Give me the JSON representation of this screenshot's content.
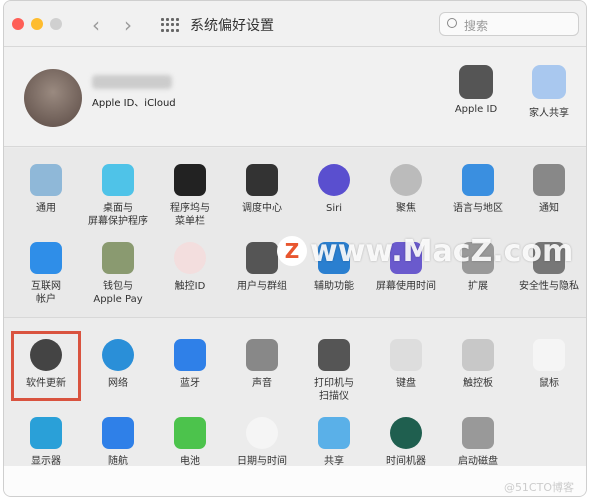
{
  "window": {
    "title": "系统偏好设置",
    "search_placeholder": "搜索"
  },
  "profile": {
    "subtitle": "Apple ID、iCloud",
    "items": [
      {
        "label": "Apple ID",
        "icon": "apple-icon"
      },
      {
        "label": "家人共享",
        "icon": "family-icon"
      }
    ]
  },
  "rows": [
    [
      {
        "label": "通用",
        "icon": "general-icon",
        "color": "#8fb8d8"
      },
      {
        "label": "桌面与\n屏幕保护程序",
        "icon": "desktop-icon",
        "color": "#4fc3e8"
      },
      {
        "label": "程序坞与\n菜单栏",
        "icon": "dock-icon",
        "color": "#222222"
      },
      {
        "label": "调度中心",
        "icon": "mission-control-icon",
        "color": "#333333"
      },
      {
        "label": "Siri",
        "icon": "siri-icon",
        "color": "#5a4fcf"
      },
      {
        "label": "聚焦",
        "icon": "spotlight-icon",
        "color": "#bbbbbb"
      },
      {
        "label": "语言与地区",
        "icon": "language-icon",
        "color": "#3a8fe0"
      },
      {
        "label": "通知",
        "icon": "notification-icon",
        "color": "#888888"
      }
    ],
    [
      {
        "label": "互联网\n帐户",
        "icon": "internet-accounts-icon",
        "color": "#2f8ee8"
      },
      {
        "label": "钱包与\nApple Pay",
        "icon": "wallet-icon",
        "color": "#8a9a70"
      },
      {
        "label": "触控ID",
        "icon": "touch-id-icon",
        "color": "#f3dede"
      },
      {
        "label": "用户与群组",
        "icon": "users-icon",
        "color": "#555555"
      },
      {
        "label": "辅助功能",
        "icon": "accessibility-icon",
        "color": "#2a7fd0"
      },
      {
        "label": "屏幕使用时间",
        "icon": "screen-time-icon",
        "color": "#6a5acd"
      },
      {
        "label": "扩展",
        "icon": "extensions-icon",
        "color": "#999999"
      },
      {
        "label": "安全性与隐私",
        "icon": "security-icon",
        "color": "#777777"
      }
    ],
    [
      {
        "label": "软件更新",
        "icon": "software-update-icon",
        "color": "#444444"
      },
      {
        "label": "网络",
        "icon": "network-icon",
        "color": "#2a8fd8"
      },
      {
        "label": "蓝牙",
        "icon": "bluetooth-icon",
        "color": "#2f80e8"
      },
      {
        "label": "声音",
        "icon": "sound-icon",
        "color": "#888888"
      },
      {
        "label": "打印机与\n扫描仪",
        "icon": "printer-icon",
        "color": "#555555"
      },
      {
        "label": "键盘",
        "icon": "keyboard-icon",
        "color": "#dddddd"
      },
      {
        "label": "触控板",
        "icon": "trackpad-icon",
        "color": "#c8c8c8"
      },
      {
        "label": "鼠标",
        "icon": "mouse-icon",
        "color": "#f5f5f5"
      }
    ],
    [
      {
        "label": "显示器",
        "icon": "display-icon",
        "color": "#2aa0d8"
      },
      {
        "label": "随航",
        "icon": "sidecar-icon",
        "color": "#2f80e8"
      },
      {
        "label": "电池",
        "icon": "battery-icon",
        "color": "#4cc34c"
      },
      {
        "label": "日期与时间",
        "icon": "clock-icon",
        "color": "#f5f5f5"
      },
      {
        "label": "共享",
        "icon": "sharing-icon",
        "color": "#5ab0e8"
      },
      {
        "label": "时间机器",
        "icon": "time-machine-icon",
        "color": "#1f5f4f"
      },
      {
        "label": "启动磁盘",
        "icon": "startup-disk-icon",
        "color": "#999999"
      }
    ]
  ],
  "watermark": {
    "text": "www.MacZ.com",
    "badge": "Z",
    "corner": "@51CTO博客"
  }
}
